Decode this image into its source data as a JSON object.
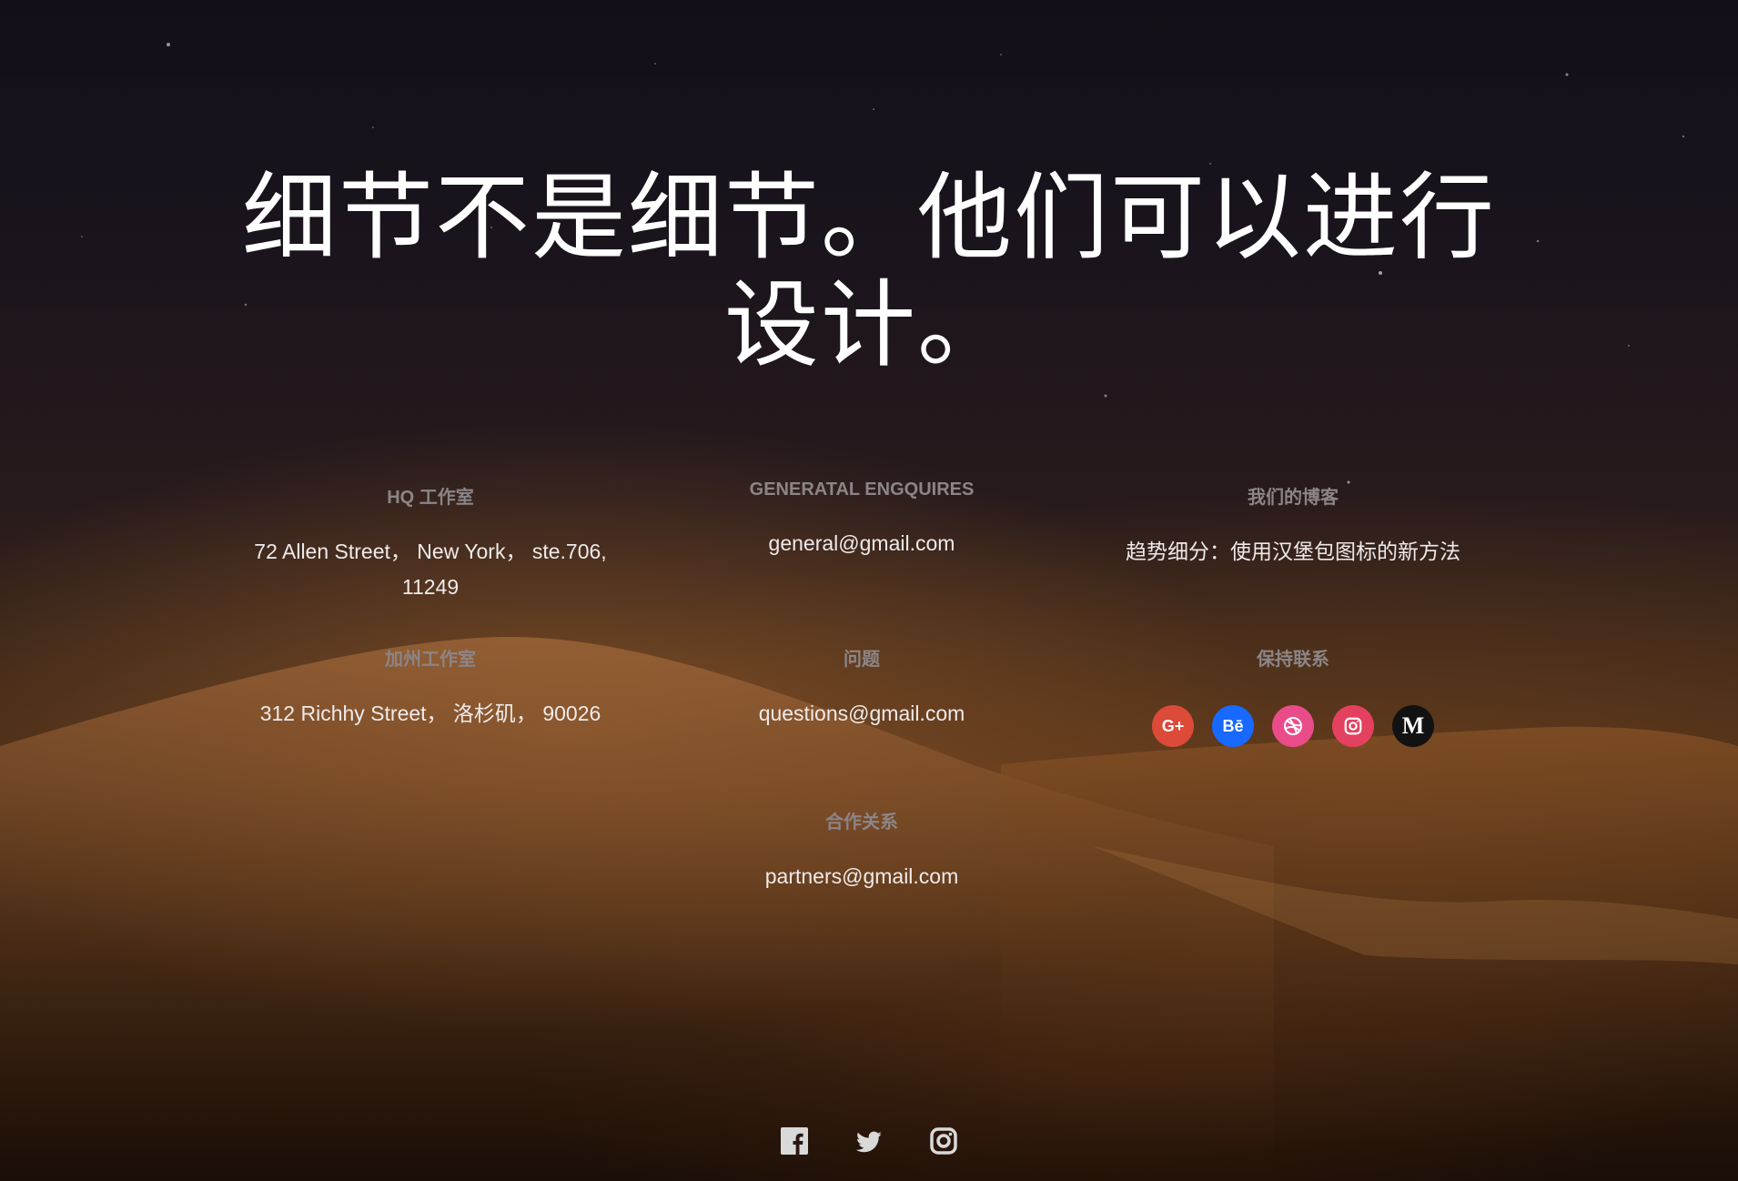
{
  "hero": {
    "line1": "细节不是细节。他们可以进行",
    "line2": "设计。"
  },
  "columns": {
    "hq": {
      "label": "HQ 工作室",
      "address_line1": "72 Allen Street， New York， ste.706,",
      "address_line2": "11249"
    },
    "general": {
      "label": "GENERATAL ENGQUIRES",
      "email": "general@gmail.com"
    },
    "blog": {
      "label": "我们的博客",
      "post": "趋势细分：使用汉堡包图标的新方法"
    },
    "ca": {
      "label": "加州工作室",
      "address": "312 Richhy Street， 洛杉矶， 90026"
    },
    "questions": {
      "label": "问题",
      "email": "questions@gmail.com"
    },
    "contact": {
      "label": "保持联系",
      "icons": [
        {
          "name": "google-plus-icon",
          "text": "G+",
          "color": "#dc4a38"
        },
        {
          "name": "behance-icon",
          "text": "Bē",
          "color": "#1769ff"
        },
        {
          "name": "dribbble-icon",
          "text": "",
          "color": "#ea4c89"
        },
        {
          "name": "instagram-icon",
          "text": "",
          "color": "#e4405f"
        },
        {
          "name": "medium-icon",
          "text": "M",
          "color": "#121212"
        }
      ]
    },
    "partners": {
      "label": "合作关系",
      "email": "partners@gmail.com"
    }
  },
  "footer": {
    "icons": [
      "facebook-icon",
      "twitter-icon",
      "instagram-icon"
    ]
  }
}
